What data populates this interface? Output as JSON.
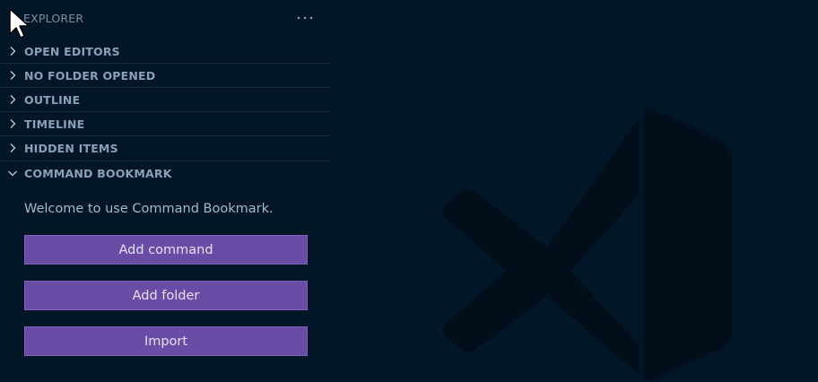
{
  "sidebar": {
    "title": "EXPLORER",
    "more_icon": "ellipsis-icon",
    "sections": [
      {
        "label": "OPEN EDITORS",
        "expanded": false
      },
      {
        "label": "NO FOLDER OPENED",
        "expanded": false
      },
      {
        "label": "OUTLINE",
        "expanded": false
      },
      {
        "label": "TIMELINE",
        "expanded": false
      },
      {
        "label": "HIDDEN ITEMS",
        "expanded": false
      },
      {
        "label": "COMMAND BOOKMARK",
        "expanded": true
      }
    ],
    "bookmark_panel": {
      "welcome_text": "Welcome to use Command Bookmark.",
      "buttons": {
        "add_command": "Add command",
        "add_folder": "Add folder",
        "import": "Import"
      }
    }
  },
  "colors": {
    "background": "#011627",
    "button": "#6a4ca6",
    "section_label": "#8aa0b8",
    "watermark": "#021019"
  }
}
